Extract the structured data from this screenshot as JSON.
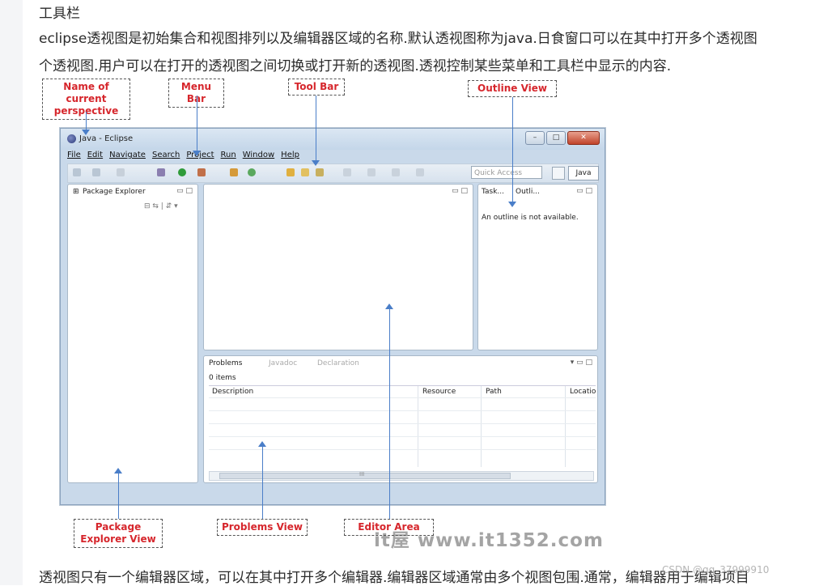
{
  "heading": "工具栏",
  "paragraph1": "eclipse透视图是初始集合和视图排列以及编辑器区域的名称.默认透视图称为java.日食窗口可以在其中打开多个透视图",
  "paragraph2": "个透视图.用户可以在打开的透视图之间切换或打开新的透视图.透视控制某些菜单和工具栏中显示的内容.",
  "paragraph3": "透视图只有一个编辑器区域，可以在其中打开多个编辑器.编辑器区域通常由多个视图包围.通常，编辑器用于编辑项目",
  "screenshot": {
    "window_title": "Java - Eclipse",
    "menus": [
      "File",
      "Edit",
      "Navigate",
      "Search",
      "Project",
      "Run",
      "Window",
      "Help"
    ],
    "quick_access": "Quick Access",
    "perspective_button": "Java",
    "package_explorer_tab": "Package Explorer",
    "outline_tabs": [
      "Task...",
      "Outli..."
    ],
    "outline_message": "An outline is not available.",
    "bottom_tabs": [
      "Problems",
      "Javadoc",
      "Declaration"
    ],
    "items_count": "0 items",
    "columns": [
      "Description",
      "Resource",
      "Path",
      "Locatio"
    ],
    "scroll_marker": "III"
  },
  "labels": {
    "perspective": "Name of current perspective",
    "menu_bar": "Menu Bar",
    "tool_bar": "Tool Bar",
    "outline_view": "Outline View",
    "package_explorer": "Package Explorer View",
    "problems_view": "Problems View",
    "editor_area": "Editor Area"
  },
  "watermark": "it屋 www.it1352.com",
  "csdn_watermark": "CSDN @qq_37999910",
  "colors": {
    "label_text": "#d6262c",
    "arrow": "#4a7ec8"
  }
}
